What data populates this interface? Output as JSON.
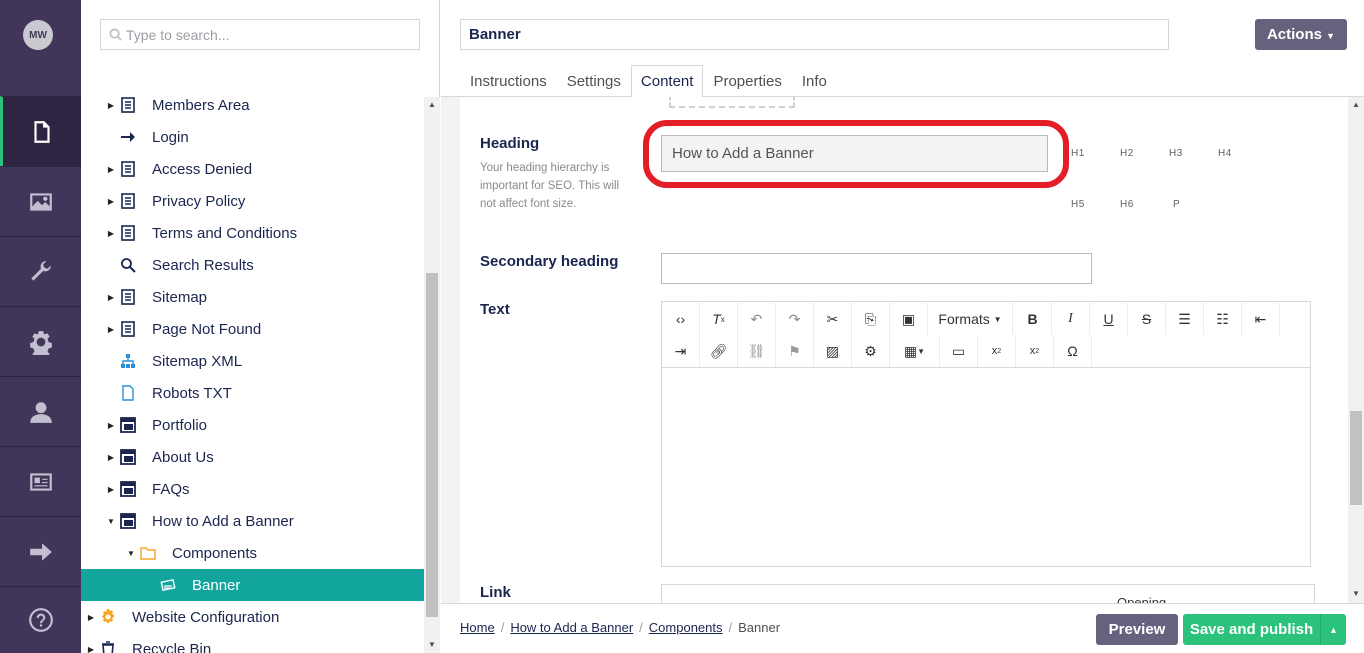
{
  "user": {
    "initials": "MW"
  },
  "nav": [
    {
      "name": "content",
      "icon": "document-icon"
    },
    {
      "name": "media",
      "icon": "image-icon"
    },
    {
      "name": "settings",
      "icon": "wrench-icon"
    },
    {
      "name": "developer",
      "icon": "gear-icon"
    },
    {
      "name": "users",
      "icon": "user-icon"
    },
    {
      "name": "members",
      "icon": "id-card-icon"
    },
    {
      "name": "forms",
      "icon": "arrow-right-icon"
    },
    {
      "name": "help",
      "icon": "help-icon"
    }
  ],
  "tree": {
    "search_placeholder": "Type to search...",
    "items": [
      {
        "label": "Members Area",
        "icon": "page-icon"
      },
      {
        "label": "Login",
        "icon": "arrow-right-icon"
      },
      {
        "label": "Access Denied",
        "icon": "page-icon"
      },
      {
        "label": "Privacy Policy",
        "icon": "page-icon"
      },
      {
        "label": "Terms and Conditions",
        "icon": "page-icon"
      },
      {
        "label": "Search Results",
        "icon": "search-icon"
      },
      {
        "label": "Sitemap",
        "icon": "page-icon"
      },
      {
        "label": "Page Not Found",
        "icon": "page-icon"
      },
      {
        "label": "Sitemap XML",
        "icon": "sitemap-icon"
      },
      {
        "label": "Robots TXT",
        "icon": "file-icon"
      },
      {
        "label": "Portfolio",
        "icon": "layout-icon"
      },
      {
        "label": "About Us",
        "icon": "layout-icon"
      },
      {
        "label": "FAQs",
        "icon": "layout-icon"
      },
      {
        "label": "How to Add a Banner",
        "icon": "layout-icon"
      },
      {
        "label": "Components",
        "icon": "folder-icon"
      },
      {
        "label": "Banner",
        "icon": "banner-icon"
      },
      {
        "label": "Website Configuration",
        "icon": "config-gear-icon"
      },
      {
        "label": "Recycle Bin",
        "icon": "trash-icon"
      }
    ]
  },
  "editor": {
    "name_value": "Banner",
    "actions_label": "Actions",
    "tabs": [
      "Instructions",
      "Settings",
      "Content",
      "Properties",
      "Info"
    ],
    "heading": {
      "label": "Heading",
      "description": "Your heading hierarchy is important for SEO. This will not affect font size.",
      "value": "How to Add a Banner",
      "levels": [
        "H1",
        "H2",
        "H3",
        "H4",
        "H5",
        "H6",
        "P"
      ]
    },
    "secondary_heading": {
      "label": "Secondary heading",
      "value": ""
    },
    "text": {
      "label": "Text",
      "formats_label": "Formats"
    },
    "link": {
      "label": "Link",
      "peek": "Opening"
    }
  },
  "footer": {
    "breadcrumb": [
      "Home",
      "How to Add a Banner",
      "Components",
      "Banner"
    ],
    "preview_label": "Preview",
    "publish_label": "Save and publish"
  },
  "colors": {
    "rail": "#413659",
    "accent": "#2bc37c",
    "selected": "#11a59d",
    "highlight": "#e31e27"
  }
}
